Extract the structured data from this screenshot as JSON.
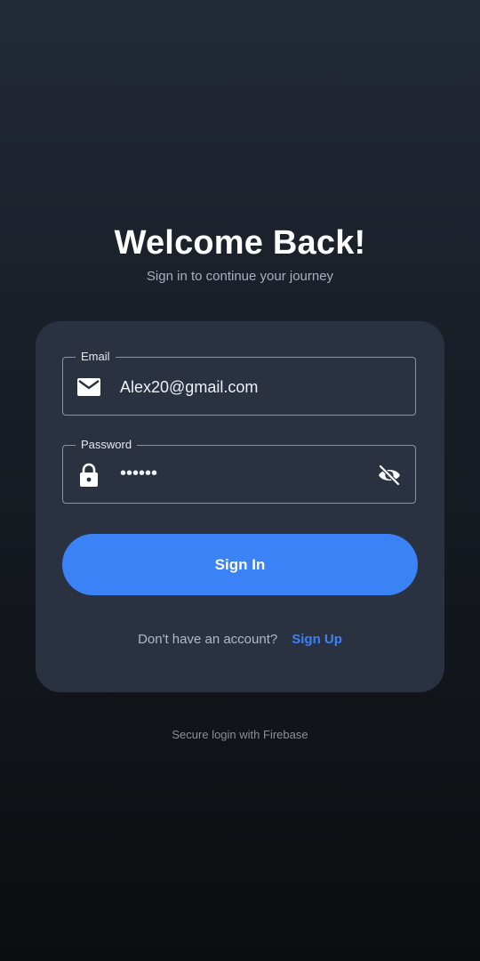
{
  "header": {
    "title": "Welcome Back!",
    "subtitle": "Sign in to continue your journey"
  },
  "form": {
    "email": {
      "label": "Email",
      "value": "Alex20@gmail.com",
      "icon": "mail-icon"
    },
    "password": {
      "label": "Password",
      "value": "••••••",
      "icon": "lock-icon",
      "toggle_icon": "eye-off-icon"
    },
    "submit_label": "Sign In",
    "signup_prompt": "Don't have an account?",
    "signup_link": "Sign Up"
  },
  "footer": {
    "text": "Secure login with Firebase"
  },
  "colors": {
    "accent": "#3b82f6",
    "card": "#2a3241",
    "background_top": "#222a37",
    "background_bottom": "#0c0d10"
  }
}
